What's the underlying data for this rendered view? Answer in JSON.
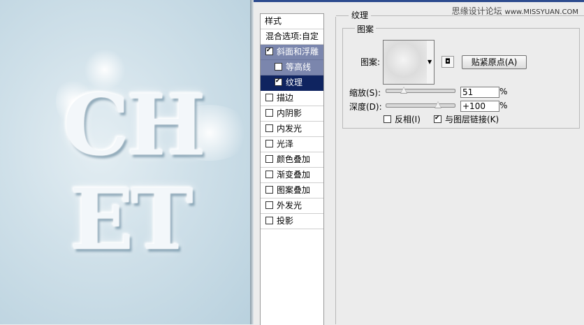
{
  "preview": {
    "line1": "CH",
    "line2": "ET"
  },
  "watermark": {
    "brand": "思缘设计论坛",
    "url": "www.MISSYUAN.COM"
  },
  "style_list": {
    "header": "样式",
    "blend": "混合选项:自定",
    "items": [
      {
        "label": "斜面和浮雕",
        "checked": true
      },
      {
        "label": "等高线",
        "checked": false
      },
      {
        "label": "纹理",
        "checked": true
      },
      {
        "label": "描边",
        "checked": false
      },
      {
        "label": "内阴影",
        "checked": false
      },
      {
        "label": "内发光",
        "checked": false
      },
      {
        "label": "光泽",
        "checked": false
      },
      {
        "label": "颜色叠加",
        "checked": false
      },
      {
        "label": "渐变叠加",
        "checked": false
      },
      {
        "label": "图案叠加",
        "checked": false
      },
      {
        "label": "外发光",
        "checked": false
      },
      {
        "label": "投影",
        "checked": false
      }
    ]
  },
  "texture_panel": {
    "title": "纹理",
    "group_title": "图案",
    "pattern_label": "图案:",
    "snap_button": "贴紧原点(A)",
    "scale": {
      "label": "缩放(S):",
      "value": "51",
      "unit": "%",
      "slider_fraction": 0.25
    },
    "depth": {
      "label": "深度(D):",
      "value": "+100",
      "unit": "%",
      "slider_fraction": 0.75
    },
    "invert": {
      "label": "反相(I)",
      "checked": false
    },
    "link": {
      "label": "与图层链接(K)",
      "checked": true
    }
  }
}
